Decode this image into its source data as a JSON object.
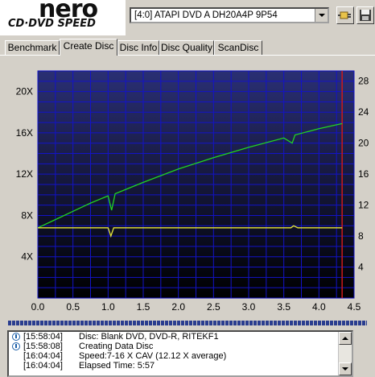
{
  "logo": {
    "brand": "nero",
    "product": "CD·DVD SPEED"
  },
  "drive": {
    "selected": "[4:0]  ATAPI DVD A  DH20A4P 9P54"
  },
  "toolbar": {
    "connect_icon": "plug-icon",
    "save_icon": "disk-save-icon"
  },
  "tabs": [
    {
      "label": "Benchmark",
      "active": false
    },
    {
      "label": "Create Disc",
      "active": true
    },
    {
      "label": "Disc Info",
      "active": false
    },
    {
      "label": "Disc Quality",
      "active": false
    },
    {
      "label": "ScanDisc",
      "active": false
    }
  ],
  "chart_data": {
    "type": "line",
    "title": "",
    "xlabel": "",
    "ylabel": "",
    "xlim": [
      0,
      4.5
    ],
    "ylim_left": [
      0,
      22
    ],
    "ylim_right": [
      0,
      29.3
    ],
    "x_ticks": [
      "0.0",
      "0.5",
      "1.0",
      "1.5",
      "2.0",
      "2.5",
      "3.0",
      "3.5",
      "4.0",
      "4.5"
    ],
    "y_left_ticks": [
      "4X",
      "8X",
      "12X",
      "16X",
      "20X"
    ],
    "y_right_ticks": [
      "4",
      "8",
      "12",
      "16",
      "20",
      "24",
      "28"
    ],
    "background_colors": [
      "#2a2f74",
      "#000000"
    ],
    "grid": true,
    "grid_color": "#1313c8",
    "marker_x": 4.33,
    "marker_color": "#cc1a1a",
    "series": [
      {
        "color": "#22d422",
        "points": [
          [
            0.0,
            6.8
          ],
          [
            0.25,
            7.6
          ],
          [
            0.5,
            8.4
          ],
          [
            0.75,
            9.2
          ],
          [
            1.0,
            9.9
          ],
          [
            1.05,
            8.5
          ],
          [
            1.1,
            10.1
          ],
          [
            1.5,
            11.2
          ],
          [
            2.0,
            12.5
          ],
          [
            2.5,
            13.6
          ],
          [
            3.0,
            14.6
          ],
          [
            3.5,
            15.5
          ],
          [
            3.62,
            15.0
          ],
          [
            3.66,
            15.8
          ],
          [
            4.0,
            16.4
          ],
          [
            4.33,
            16.9
          ]
        ]
      },
      {
        "color": "#e7e73a",
        "points": [
          [
            0.0,
            6.8
          ],
          [
            0.5,
            6.8
          ],
          [
            1.0,
            6.8
          ],
          [
            1.04,
            6.0
          ],
          [
            1.08,
            6.8
          ],
          [
            2.0,
            6.8
          ],
          [
            3.0,
            6.8
          ],
          [
            3.6,
            6.8
          ],
          [
            3.64,
            7.0
          ],
          [
            3.7,
            6.8
          ],
          [
            4.33,
            6.8
          ]
        ]
      }
    ]
  },
  "log": [
    {
      "time": "[15:58:04]",
      "message": "Disc: Blank DVD, DVD-R, RITEKF1"
    },
    {
      "time": "[15:58:08]",
      "message": "Creating Data Disc"
    },
    {
      "time": "[16:04:04]",
      "message": "Speed:7-16 X CAV (12.12 X average)"
    },
    {
      "time": "[16:04:04]",
      "message": "Elapsed Time:  5:57"
    }
  ]
}
